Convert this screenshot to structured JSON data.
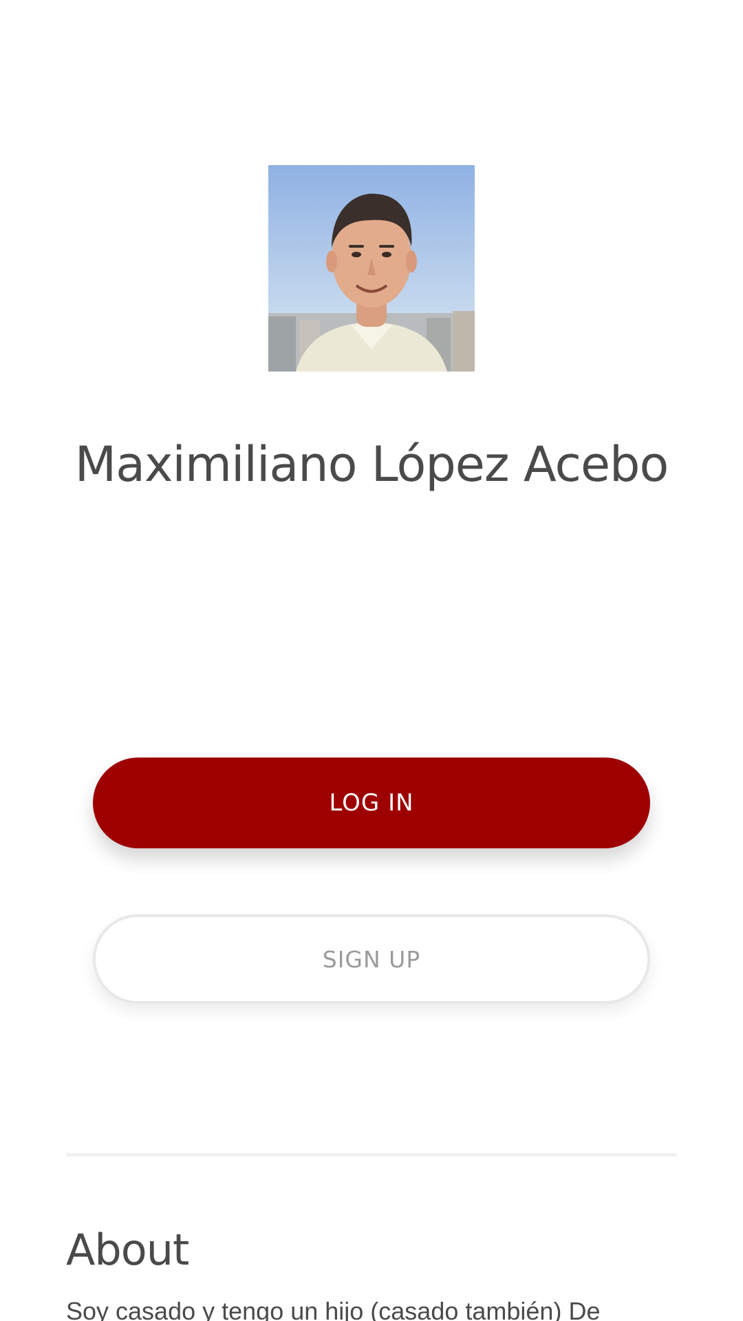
{
  "profile": {
    "name": "Maximiliano López Acebo",
    "photo_icon": "profile-photo"
  },
  "actions": {
    "login_label": "LOG IN",
    "signup_label": "SIGN UP"
  },
  "about": {
    "title": "About",
    "text": "Soy casado y tengo un hijo (casado también) De"
  },
  "colors": {
    "primary": "#9e0000",
    "text": "#4a4a4a",
    "muted": "#9a9a9a"
  }
}
